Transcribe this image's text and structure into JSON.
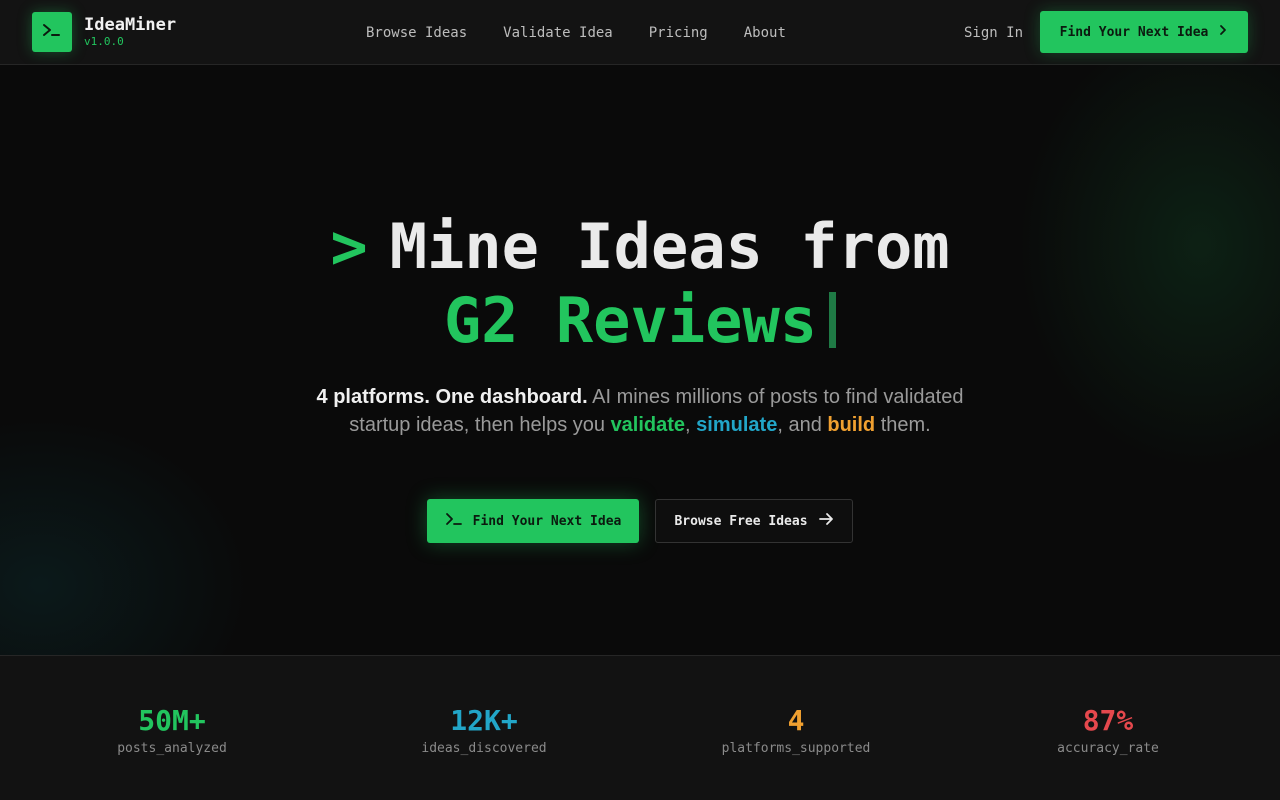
{
  "header": {
    "logo_name": "IdeaMiner",
    "logo_version": "v1.0.0",
    "nav": [
      "Browse Ideas",
      "Validate Idea",
      "Pricing",
      "About"
    ],
    "signin": "Sign In",
    "cta": "Find Your Next Idea"
  },
  "hero": {
    "prompt": ">",
    "title_line1": "Mine Ideas from",
    "title_line2": "G2 Reviews",
    "sub_bold": "4 platforms. One dashboard.",
    "sub_text1": " AI mines millions of posts to find validated startup ideas, then helps you ",
    "sub_validate": "validate",
    "sub_comma": ", ",
    "sub_simulate": "simulate",
    "sub_and": ", and ",
    "sub_build": "build",
    "sub_end": " them.",
    "primary_button": "Find Your Next Idea",
    "secondary_button": "Browse Free Ideas"
  },
  "stats": [
    {
      "value": "50M+",
      "label": "posts_analyzed",
      "color": "#22c55e"
    },
    {
      "value": "12K+",
      "label": "ideas_discovered",
      "color": "#22a6c8"
    },
    {
      "value": "4",
      "label": "platforms_supported",
      "color": "#f0a030"
    },
    {
      "value": "87%",
      "label": "accuracy_rate",
      "color": "#e5484d"
    }
  ],
  "colors": {
    "accent": "#22c55e",
    "cyan": "#22a6c8",
    "orange": "#f0a030",
    "red": "#e5484d"
  },
  "icons": {
    "logo": "terminal-icon",
    "cta": "chevron-right-icon",
    "primary": "terminal-icon",
    "secondary": "arrow-right-icon"
  }
}
